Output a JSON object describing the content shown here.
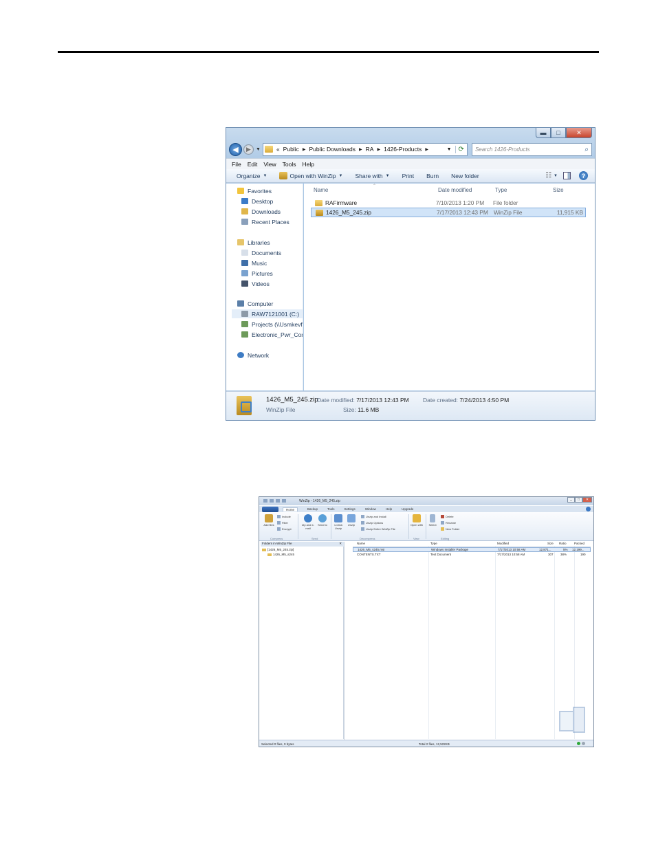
{
  "explorer": {
    "breadcrumb": {
      "overflow": "«",
      "items": [
        "Public",
        "Public Downloads",
        "RA",
        "1426-Products"
      ]
    },
    "search_placeholder": "Search 1426-Products",
    "menu": [
      "File",
      "Edit",
      "View",
      "Tools",
      "Help"
    ],
    "toolbar": {
      "organize": "Organize",
      "open_with": "Open with WinZip",
      "share_with": "Share with",
      "print": "Print",
      "burn": "Burn",
      "new_folder": "New folder"
    },
    "nav": {
      "favorites": "Favorites",
      "desktop": "Desktop",
      "downloads": "Downloads",
      "recent_places": "Recent Places",
      "libraries": "Libraries",
      "documents": "Documents",
      "music": "Music",
      "pictures": "Pictures",
      "videos": "Videos",
      "computer": "Computer",
      "drive_c": "RAW7121001 (C:)",
      "projects": "Projects (\\\\Usmkevfil",
      "electronic": "Electronic_Pwr_Comp",
      "network": "Network"
    },
    "columns": {
      "name": "Name",
      "date_modified": "Date modified",
      "type": "Type",
      "size": "Size"
    },
    "files": [
      {
        "name": "RAFirmware",
        "date": "7/10/2013 1:20 PM",
        "type": "File folder",
        "size": ""
      },
      {
        "name": "1426_M5_245.zip",
        "date": "7/17/2013 12:43 PM",
        "type": "WinZip File",
        "size": "11,915 KB"
      }
    ],
    "details": {
      "filename": "1426_M5_245.zip",
      "filetype": "WinZip File",
      "date_modified_label": "Date modified:",
      "date_modified": "7/17/2013 12:43 PM",
      "size_label": "Size:",
      "size": "11.6 MB",
      "date_created_label": "Date created:",
      "date_created": "7/24/2013 4:50 PM"
    }
  },
  "winzip": {
    "title": "WinZip - 1426_M5_245.zip",
    "tabs": [
      "Home",
      "Backup",
      "Tools",
      "Settings",
      "Window",
      "Help",
      "Upgrade"
    ],
    "ribbon": {
      "add_files": "Add files",
      "include": "Include",
      "filter": "Filter",
      "encrypt": "Encrypt",
      "compress": "Compress",
      "zip_email": "Zip and e-mail",
      "send_to": "Send to",
      "send": "Send",
      "one_click": "1-Click Unzip",
      "unzip": "Unzip",
      "unzip_install": "Unzip and Install",
      "unzip_options": "Unzip Options",
      "unzip_entire": "Unzip Entire WinZip File",
      "decompress": "Decompress",
      "open_with": "Open with",
      "view": "View",
      "select": "Select",
      "delete": "Delete",
      "rename": "Rename",
      "new_folder": "New Folder",
      "editing": "Editing"
    },
    "tree_header": "Folders in WinZip File",
    "tree": [
      "[1426_M5_245.zip]",
      "1426_M5_s245"
    ],
    "columns": {
      "name": "Name",
      "type": "Type",
      "modified": "Modified",
      "size": "Size",
      "ratio": "Ratio",
      "packed": "Packed"
    },
    "rows": [
      {
        "name": "1426_M5_s245.msi",
        "type": "Windows Installer Package",
        "modified": "7/17/2013 10:58 AM",
        "size": "12,871...",
        "ratio": "5%",
        "packed": "12,199..."
      },
      {
        "name": "CONTENTS.TXT",
        "type": "Text Document",
        "modified": "7/17/2013 10:58 AM",
        "size": "307",
        "ratio": "38%",
        "packed": "190"
      }
    ],
    "status_left": "Selected 0 files, 0 bytes",
    "status_right": "Total 2 files, 12,522KB"
  }
}
